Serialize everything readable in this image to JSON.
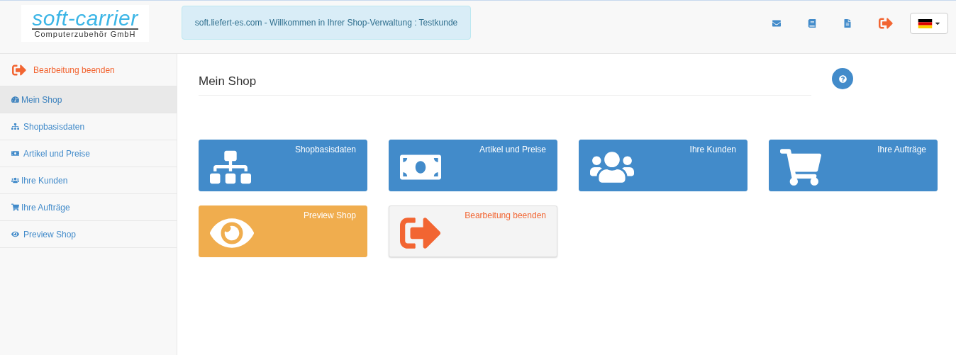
{
  "header": {
    "logo": {
      "name": "soft-carrier",
      "tagline": "Computerzubehör GmbH"
    },
    "welcome": "soft.liefert-es.com - Willkommen in Ihrer Shop-Verwaltung : Testkunde"
  },
  "sidebar": {
    "exit": "Bearbeitung beenden",
    "items": [
      {
        "label": "Mein Shop",
        "selected": true
      },
      {
        "label": "Shopbasisdaten",
        "selected": false
      },
      {
        "label": "Artikel und Preise",
        "selected": false
      },
      {
        "label": "Ihre Kunden",
        "selected": false
      },
      {
        "label": "Ihre Aufträge",
        "selected": false
      },
      {
        "label": "Preview Shop",
        "selected": false
      }
    ]
  },
  "page": {
    "title": "Mein Shop",
    "tiles": [
      {
        "label": "Shopbasisdaten",
        "kind": "primary"
      },
      {
        "label": "Artikel und Preise",
        "kind": "primary"
      },
      {
        "label": "Ihre Kunden",
        "kind": "primary"
      },
      {
        "label": "Ihre Aufträge",
        "kind": "primary"
      },
      {
        "label": "Preview Shop",
        "kind": "warning"
      },
      {
        "label": "Bearbeitung beenden",
        "kind": "default"
      }
    ]
  }
}
